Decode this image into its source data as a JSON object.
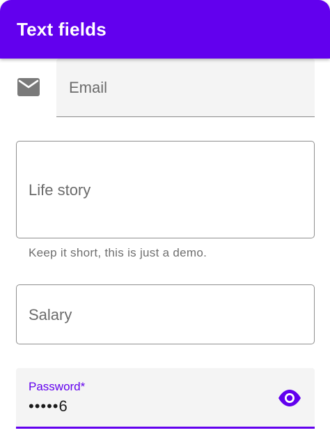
{
  "appbar": {
    "title": "Text fields",
    "color": "#6200ee"
  },
  "email_field": {
    "icon": "mail-icon",
    "placeholder": "Email",
    "value": ""
  },
  "life_story_field": {
    "placeholder": "Life story",
    "value": "",
    "helper_text": "Keep it short, this is just a demo."
  },
  "salary_field": {
    "placeholder": "Salary",
    "value": ""
  },
  "password_field": {
    "label": "Password*",
    "value": "•••••6",
    "toggle_icon": "eye-icon",
    "focused": true
  },
  "colors": {
    "accent": "#6200ee",
    "filled_background": "#f4f4f4",
    "placeholder_text": "#6b6b6b",
    "outline": "#8e8e8e"
  }
}
